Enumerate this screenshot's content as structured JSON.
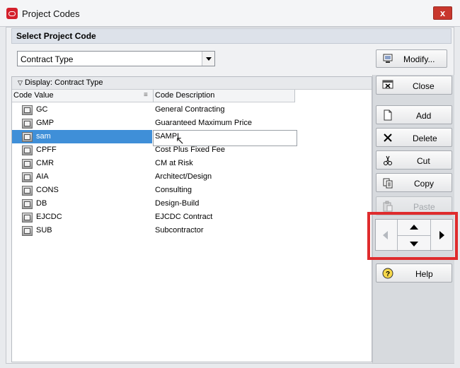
{
  "window": {
    "title": "Project Codes",
    "close_label": "x"
  },
  "header": {
    "section_title": "Select Project Code"
  },
  "selector": {
    "value": "Contract Type"
  },
  "modify_button": {
    "label": "Modify..."
  },
  "grid": {
    "display_label": "Display: Contract Type",
    "columns": [
      "Code Value",
      "Code Description"
    ],
    "rows": [
      {
        "code": "GC",
        "description": "General Contracting"
      },
      {
        "code": "GMP",
        "description": "Guaranteed Maximum Price"
      },
      {
        "code": "sam",
        "description": "SAMPL",
        "selected": true,
        "editing": true
      },
      {
        "code": "CPFF",
        "description": "Cost Plus Fixed Fee"
      },
      {
        "code": "CMR",
        "description": "CM at Risk"
      },
      {
        "code": "AIA",
        "description": "Architect/Design"
      },
      {
        "code": "CONS",
        "description": "Consulting"
      },
      {
        "code": "DB",
        "description": "Design-Build"
      },
      {
        "code": "EJCDC",
        "description": "EJCDC Contract"
      },
      {
        "code": "SUB",
        "description": "Subcontractor"
      }
    ]
  },
  "actions": {
    "close": "Close",
    "add": "Add",
    "delete": "Delete",
    "cut": "Cut",
    "copy": "Copy",
    "paste": "Paste",
    "help": "Help"
  },
  "icons": {
    "app": "oracle-app-icon",
    "modify": "monitor-icon",
    "close": "close-window-icon",
    "add": "new-document-icon",
    "delete": "delete-x-icon",
    "cut": "scissors-icon",
    "copy": "copy-icon",
    "paste": "paste-icon",
    "help": "help-icon"
  },
  "colors": {
    "selection": "#3f8fd8",
    "highlight_box": "#df2b2d",
    "title_close": "#c8372d"
  }
}
